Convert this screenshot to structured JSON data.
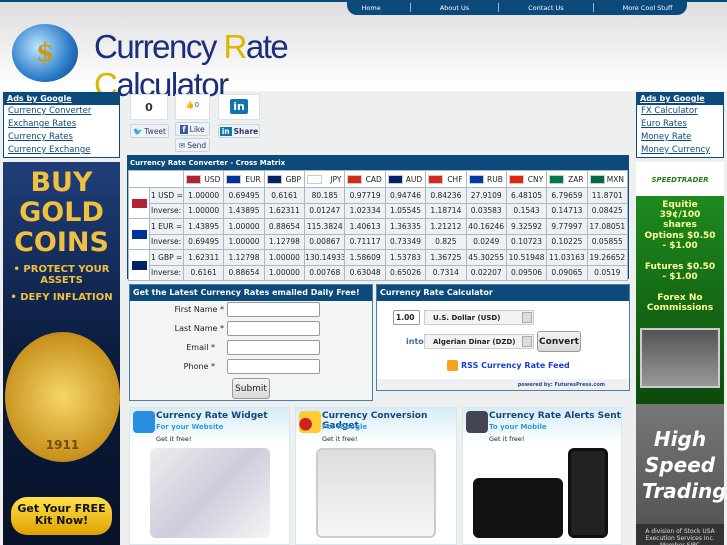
{
  "nav": [
    "Home",
    "About Us",
    "Contact Us",
    "More Cool Stuff"
  ],
  "logo": {
    "text_a": "Currency ",
    "text_b": "R",
    "text_c": "ate ",
    "text_d": "C",
    "text_e": "alculator",
    "symbol": "$"
  },
  "left_ads": {
    "header": "Ads by Google",
    "links": [
      "Currency Converter",
      "Exchange Rates",
      "Currency Rates",
      "Currency Exchange"
    ]
  },
  "right_ads": {
    "header": "Ads by Google",
    "links": [
      "FX Calculator",
      "Euro Rates",
      "Money Rate",
      "Money Currency"
    ]
  },
  "social": {
    "tweet_count": "0",
    "tweet": "Tweet",
    "like_count": "0",
    "like": "Like",
    "send": "Send",
    "share": "Share",
    "linkedin": "in"
  },
  "matrix": {
    "title": "Currency Rate Converter - Cross Matrix",
    "currencies": [
      "USD",
      "EUR",
      "GBP",
      "JPY",
      "CAD",
      "AUD",
      "CHF",
      "RUB",
      "CNY",
      "ZAR",
      "MXN"
    ],
    "flag_colors": {
      "USD": "#b22234",
      "EUR": "#003399",
      "GBP": "#012169",
      "JPY": "#ffffff",
      "CAD": "#d52b1e",
      "AUD": "#012169",
      "CHF": "#d52b1e",
      "RUB": "#0039a6",
      "CNY": "#de2910",
      "ZAR": "#007a4d",
      "MXN": "#006847"
    },
    "rows": [
      {
        "base": "USD",
        "label": "1 USD =",
        "values": [
          "1.00000",
          "0.69495",
          "0.6161",
          "80.185",
          "0.97719",
          "0.94746",
          "0.84236",
          "27.9109",
          "6.48105",
          "6.79659",
          "11.8701"
        ],
        "inverse_label": "Inverse:",
        "inverse": [
          "1.00000",
          "1.43895",
          "1.62311",
          "0.01247",
          "1.02334",
          "1.05545",
          "1.18714",
          "0.03583",
          "0.1543",
          "0.14713",
          "0.08425"
        ]
      },
      {
        "base": "EUR",
        "label": "1 EUR =",
        "values": [
          "1.43895",
          "1.00000",
          "0.88654",
          "115.3824",
          "1.40613",
          "1.36335",
          "1.21212",
          "40.16246",
          "9.32592",
          "9.77997",
          "17.08051"
        ],
        "inverse_label": "Inverse:",
        "inverse": [
          "0.69495",
          "1.00000",
          "1.12798",
          "0.00867",
          "0.71117",
          "0.73349",
          "0.825",
          "0.0249",
          "0.10723",
          "0.10225",
          "0.05855"
        ]
      },
      {
        "base": "GBP",
        "label": "1 GBP =",
        "values": [
          "1.62311",
          "1.12798",
          "1.00000",
          "130.14933",
          "1.58609",
          "1.53783",
          "1.36725",
          "45.30255",
          "10.51948",
          "11.03163",
          "19.26652"
        ],
        "inverse_label": "Inverse:",
        "inverse": [
          "0.6161",
          "0.88654",
          "1.00000",
          "0.00768",
          "0.63048",
          "0.65026",
          "0.7314",
          "0.02207",
          "0.09506",
          "0.09065",
          "0.0519"
        ]
      }
    ]
  },
  "email_form": {
    "title": "Get the Latest Currency Rates emailed Daily Free!",
    "fields": [
      "First Name *",
      "Last Name *",
      "Email *",
      "Phone *"
    ],
    "submit": "Submit"
  },
  "calculator": {
    "title": "Currency Rate Calculator",
    "amount": "1.00",
    "from": "U.S. Dollar (USD)",
    "into_label": "into",
    "to": "Algerian Dinar (DZD)",
    "convert": "Convert",
    "rss": "RSS Currency Rate Feed",
    "powered": "powered by: FuturesPress.com"
  },
  "widgets": [
    {
      "title": "Currency Rate Widget",
      "sub": "For your Website",
      "cta": "Get it free!"
    },
    {
      "title": "Currency Conversion Gadget",
      "sub": "For iGoogle",
      "cta": "Get it free!"
    },
    {
      "title": "Currency Rate Alerts Sent",
      "sub": "To your Mobile",
      "cta": "Get it free!"
    }
  ],
  "left_banner": {
    "l1": "BUY",
    "l2": "GOLD",
    "l3": "COINS",
    "b1": "• PROTECT YOUR ASSETS",
    "b2": "• DEFY INFLATION",
    "year": "1911",
    "cta": "Get Your FREE Kit Now!"
  },
  "right_banner": {
    "brand": "SPEEDTRADER",
    "p1": "Equitie 39¢/100 shares",
    "p2": "Options $0.50 - $1.00",
    "p3": "Futures $0.50 - $1.00",
    "p4": "Forex No Commissions",
    "slogan": "High Speed Trading",
    "foot": "A division of Stock USA Execution Services Inc. Member SIPC"
  }
}
